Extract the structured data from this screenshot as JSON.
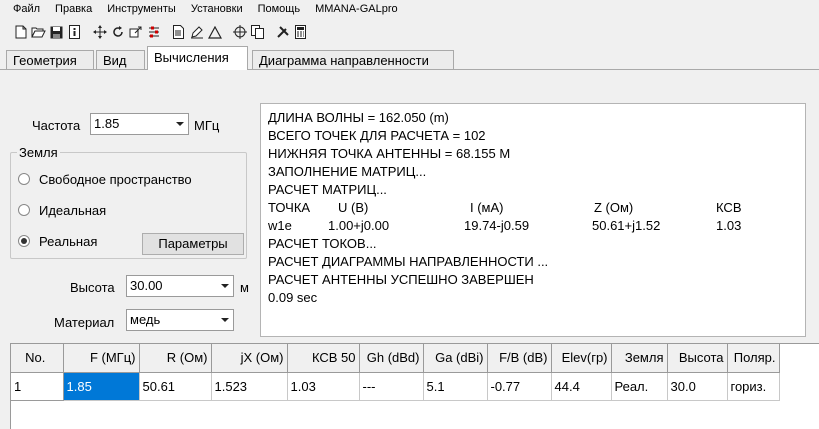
{
  "menu": [
    "Файл",
    "Правка",
    "Инструменты",
    "Установки",
    "Помощь",
    "MMANA-GALpro"
  ],
  "toolbar": {
    "icons": [
      "new-file-icon",
      "open-folder-icon",
      "save-icon",
      "info-icon",
      "move-icon",
      "rotate-icon",
      "zoom-icon",
      "sliders-icon",
      "document-icon",
      "edit-icon",
      "triangle-icon",
      "target-icon",
      "copy-icon",
      "tools-icon",
      "calculator-icon"
    ]
  },
  "tabs": [
    "Геометрия",
    "Вид",
    "Вычисления",
    "Диаграмма направленности"
  ],
  "calc": {
    "freq_label": "Частота",
    "freq_value": "1.85",
    "freq_unit": "МГц",
    "ground": {
      "title": "Земля",
      "options": [
        "Свободное пространство",
        "Идеальная",
        "Реальная"
      ],
      "selected": "Реальная"
    },
    "params_button": "Параметры",
    "height_label": "Высота",
    "height_value": "30.00",
    "height_unit": "м",
    "material_label": "Материал",
    "material_value": "медь"
  },
  "output": {
    "lines_top": [
      "ДЛИНА ВОЛНЫ = 162.050 (m)",
      "ВСЕГО ТОЧЕК ДЛЯ РАСЧЕТА = 102",
      "НИЖНЯЯ ТОЧКА АНТЕННЫ = 68.155 М",
      "ЗАПОЛНЕНИЕ МАТРИЦ...",
      "РАСЧЕТ МАТРИЦ..."
    ],
    "grid_header": [
      "ТОЧКА",
      "U (B)",
      "I (мА)",
      "Z (Ом)",
      "КСВ"
    ],
    "grid_row": [
      "w1e",
      "1.00+j0.00",
      "19.74-j0.59",
      "50.61+j1.52",
      "1.03"
    ],
    "lines_bottom": [
      "РАСЧЕТ ТОКОВ...",
      "РАСЧЕТ ДИАГРАММЫ НАПРАВЛЕННОСТИ ...",
      "РАСЧЕТ АНТЕННЫ УСПЕШНО ЗАВЕРШЕН",
      "0.09 sec"
    ]
  },
  "results_table": {
    "columns": [
      "No.",
      "F (МГц)",
      "R (Ом)",
      "jX (Ом)",
      "КСВ 50",
      "Gh (dBd)",
      "Ga (dBi)",
      "F/B (dB)",
      "Elev(гр)",
      "Земля",
      "Высота",
      "Поляр."
    ],
    "rows": [
      [
        "1",
        "1.85",
        "50.61",
        "1.523",
        "1.03",
        "---",
        "5.1",
        "-0.77",
        "44.4",
        "Реал.",
        "30.0",
        "гориз."
      ]
    ]
  }
}
